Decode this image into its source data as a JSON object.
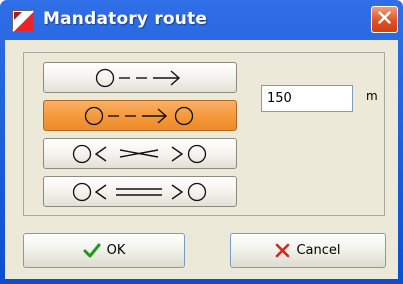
{
  "window": {
    "title": "Mandatory route"
  },
  "route_options": [
    {
      "name": "route-direction-only",
      "selected": false
    },
    {
      "name": "route-origin-to-destination",
      "selected": true
    },
    {
      "name": "route-bidirectional-x",
      "selected": false
    },
    {
      "name": "route-bidirectional-parallel",
      "selected": false
    }
  ],
  "distance": {
    "value": "150",
    "unit": "m"
  },
  "buttons": {
    "ok_label": "OK",
    "cancel_label": "Cancel"
  },
  "icons": {
    "app": "mandatory-route-app-icon",
    "close": "close-icon",
    "ok": "checkmark-icon",
    "cancel": "x-icon"
  },
  "colors": {
    "titlebar": "#0b4fd1",
    "selected_option": "#f59a3d",
    "close_button": "#e2521f",
    "ok_check": "#1f9a1f",
    "cancel_x": "#d6261b"
  }
}
